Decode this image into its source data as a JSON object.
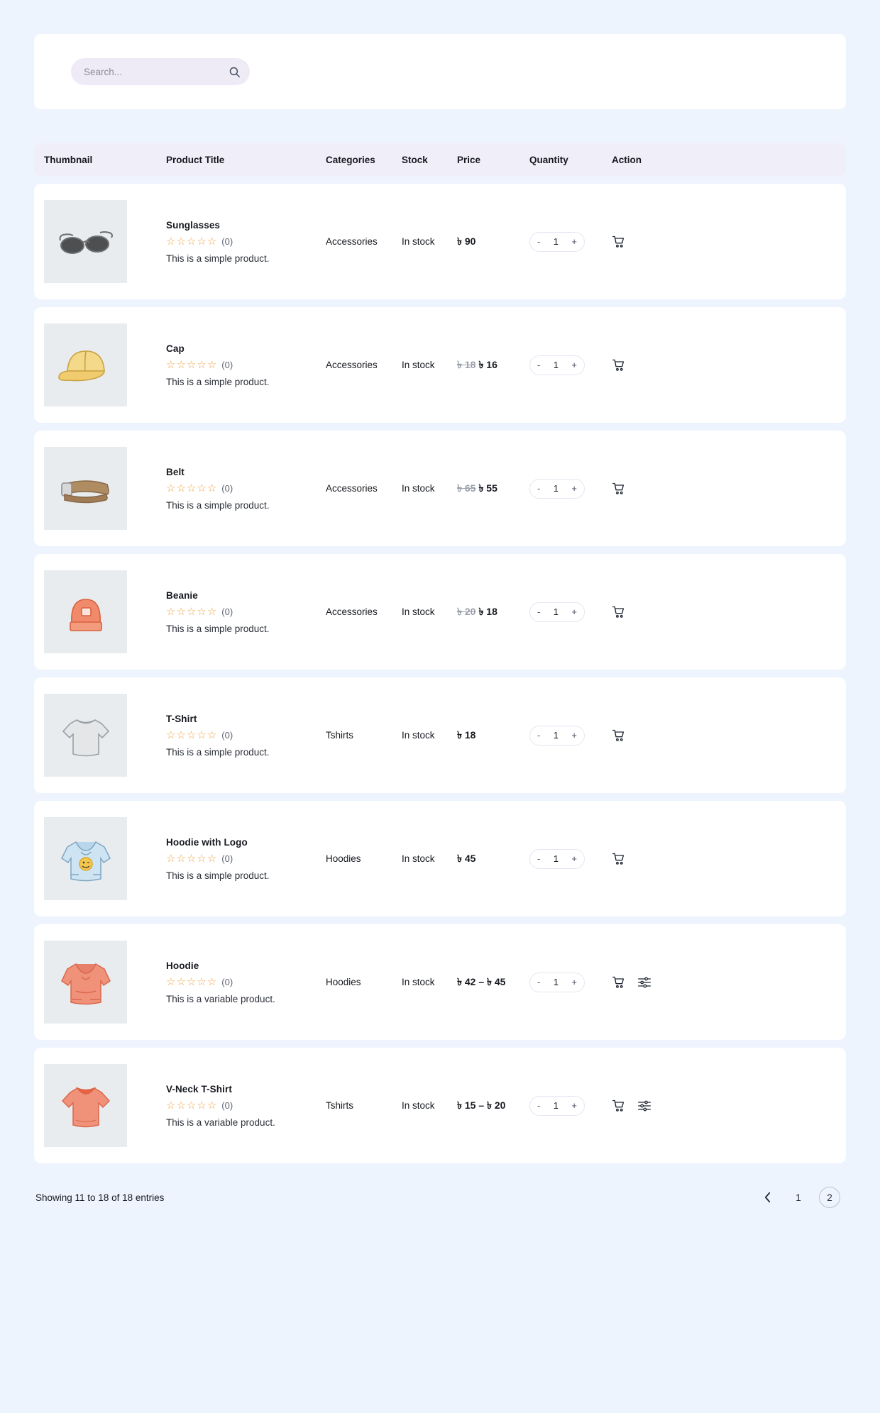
{
  "search": {
    "placeholder": "Search...",
    "value": "",
    "icon": "search-icon"
  },
  "table": {
    "headers": {
      "thumbnail": "Thumbnail",
      "product_title": "Product Title",
      "categories": "Categories",
      "stock": "Stock",
      "price": "Price",
      "quantity": "Quantity",
      "action": "Action"
    },
    "rows": [
      {
        "thumb": "sunglasses",
        "title": "Sunglasses",
        "rating_count": "(0)",
        "stars": 5,
        "desc": "This is a simple product.",
        "category": "Accessories",
        "stock": "In stock",
        "price_old": "",
        "price": "৳ 90",
        "qty": "1",
        "qty_minus": "-",
        "qty_plus": "+",
        "has_settings": false
      },
      {
        "thumb": "cap",
        "title": "Cap",
        "rating_count": "(0)",
        "stars": 5,
        "desc": "This is a simple product.",
        "category": "Accessories",
        "stock": "In stock",
        "price_old": "৳ 18",
        "price": "৳ 16",
        "qty": "1",
        "qty_minus": "-",
        "qty_plus": "+",
        "has_settings": false
      },
      {
        "thumb": "belt",
        "title": "Belt",
        "rating_count": "(0)",
        "stars": 5,
        "desc": "This is a simple product.",
        "category": "Accessories",
        "stock": "In stock",
        "price_old": "৳ 65",
        "price": "৳ 55",
        "qty": "1",
        "qty_minus": "-",
        "qty_plus": "+",
        "has_settings": false
      },
      {
        "thumb": "beanie",
        "title": "Beanie",
        "rating_count": "(0)",
        "stars": 5,
        "desc": "This is a simple product.",
        "category": "Accessories",
        "stock": "In stock",
        "price_old": "৳ 20",
        "price": "৳ 18",
        "qty": "1",
        "qty_minus": "-",
        "qty_plus": "+",
        "has_settings": false
      },
      {
        "thumb": "tshirt",
        "title": "T-Shirt",
        "rating_count": "(0)",
        "stars": 5,
        "desc": "This is a simple product.",
        "category": "Tshirts",
        "stock": "In stock",
        "price_old": "",
        "price": "৳ 18",
        "qty": "1",
        "qty_minus": "-",
        "qty_plus": "+",
        "has_settings": false
      },
      {
        "thumb": "hoodie-logo",
        "title": "Hoodie with Logo",
        "rating_count": "(0)",
        "stars": 5,
        "desc": "This is a simple product.",
        "category": "Hoodies",
        "stock": "In stock",
        "price_old": "",
        "price": "৳ 45",
        "qty": "1",
        "qty_minus": "-",
        "qty_plus": "+",
        "has_settings": false
      },
      {
        "thumb": "hoodie",
        "title": "Hoodie",
        "rating_count": "(0)",
        "stars": 5,
        "desc": "This is a variable product.",
        "category": "Hoodies",
        "stock": "In stock",
        "price_old": "",
        "price": "৳ 42 – ৳ 45",
        "qty": "1",
        "qty_minus": "-",
        "qty_plus": "+",
        "has_settings": true
      },
      {
        "thumb": "vneck",
        "title": "V-Neck T-Shirt",
        "rating_count": "(0)",
        "stars": 5,
        "desc": "This is a variable product.",
        "category": "Tshirts",
        "stock": "In stock",
        "price_old": "",
        "price": "৳ 15 – ৳ 20",
        "qty": "1",
        "qty_minus": "-",
        "qty_plus": "+",
        "has_settings": true
      }
    ]
  },
  "footer": {
    "entries": "Showing 11 to 18 of 18 entries",
    "pages": [
      "1",
      "2"
    ],
    "active_page": "2",
    "prev_icon": "chevron-left-icon"
  },
  "colors": {
    "page_bg": "#eef4fd",
    "card_bg": "#ffffff",
    "header_bg": "#f0eef9",
    "search_bg": "#eeeaf6",
    "star": "#f0a447",
    "text": "#16191f",
    "muted": "#9aa0ab"
  }
}
